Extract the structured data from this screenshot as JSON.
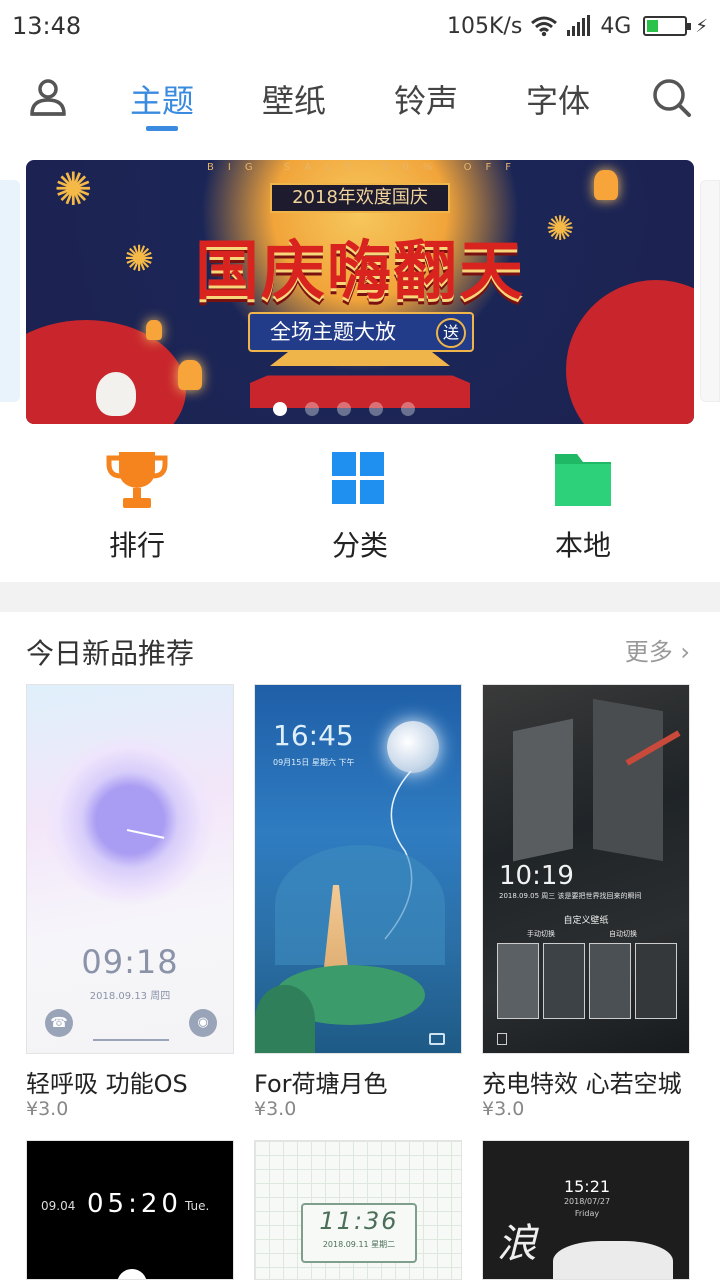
{
  "status_bar": {
    "time": "13:48",
    "speed": "105K/s",
    "network": "4G",
    "battery_level": 0.3
  },
  "header": {
    "tabs": [
      {
        "label": "主题",
        "active": true
      },
      {
        "label": "壁纸",
        "active": false
      },
      {
        "label": "铃声",
        "active": false
      },
      {
        "label": "字体",
        "active": false
      }
    ],
    "icons": [
      "user-icon",
      "search-icon"
    ]
  },
  "banner": {
    "top_tag": "2018年欢度国庆",
    "tiny_text": "BIG SALE 50% OFF",
    "title": "国庆嗨翻天",
    "subtitle": "全场主题大放",
    "badge": "送",
    "page_count": 5,
    "active_page": 1
  },
  "quick_entries": [
    {
      "label": "排行",
      "icon": "trophy-icon",
      "color": "#f5841f"
    },
    {
      "label": "分类",
      "icon": "grid-icon",
      "color": "#1f8ff0"
    },
    {
      "label": "本地",
      "icon": "folder-icon",
      "color": "#2dd17a"
    }
  ],
  "section": {
    "title": "今日新品推荐",
    "more": "更多"
  },
  "cards": [
    {
      "name": "轻呼吸 功能OS",
      "price": "¥3.0",
      "clock": "09:18",
      "date": "2018.09.13  周四"
    },
    {
      "name": "For荷塘月色",
      "price": "¥3.0",
      "clock": "16:45",
      "date": "09月15日  星期六  下午"
    },
    {
      "name": "充电特效 心若空城",
      "price": "¥3.0",
      "clock": "10:19",
      "date": "2018.09.05 周三 该是要把世界找回来的瞬间",
      "menu_title": "自定义壁纸",
      "option_a": "手动切换",
      "option_b": "自动切换"
    }
  ],
  "cards_row2": [
    {
      "clock": "05:20",
      "date": "09.04",
      "day": "Tue."
    },
    {
      "clock": "11:36",
      "date": "2018.09.11  星期二"
    },
    {
      "clock": "15:21",
      "date": "2018/07/27",
      "day": "Friday"
    }
  ],
  "colors": {
    "accent": "#3a8be0",
    "divider": "#f2f2f2"
  }
}
